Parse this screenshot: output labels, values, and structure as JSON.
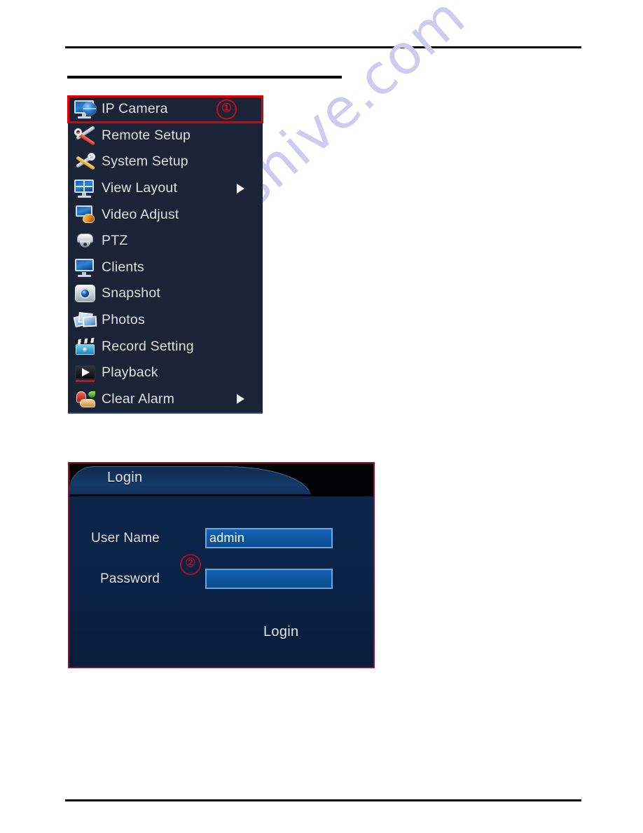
{
  "page": {
    "background_color": "#ffffff",
    "watermark": {
      "text": "manualshive.com",
      "color": "#ccccef"
    }
  },
  "context_menu": {
    "panel_color": "#1b2436",
    "highlight_color": "#e00000",
    "selected_index": 0,
    "items": [
      {
        "label": "IP Camera",
        "icon": "ip-camera-icon",
        "has_submenu": false,
        "badge": "①",
        "selected": true
      },
      {
        "label": "Remote Setup",
        "icon": "remote-setup-icon",
        "has_submenu": false,
        "badge": "",
        "selected": false
      },
      {
        "label": "System Setup",
        "icon": "system-setup-icon",
        "has_submenu": false,
        "badge": "",
        "selected": false
      },
      {
        "label": "View Layout",
        "icon": "view-layout-icon",
        "has_submenu": true,
        "badge": "",
        "selected": false
      },
      {
        "label": "Video Adjust",
        "icon": "video-adjust-icon",
        "has_submenu": false,
        "badge": "",
        "selected": false
      },
      {
        "label": "PTZ",
        "icon": "ptz-camera-icon",
        "has_submenu": false,
        "badge": "",
        "selected": false
      },
      {
        "label": "Clients",
        "icon": "clients-icon",
        "has_submenu": false,
        "badge": "",
        "selected": false
      },
      {
        "label": "Snapshot",
        "icon": "snapshot-icon",
        "has_submenu": false,
        "badge": "",
        "selected": false
      },
      {
        "label": "Photos",
        "icon": "photos-icon",
        "has_submenu": false,
        "badge": "",
        "selected": false
      },
      {
        "label": "Record Setting",
        "icon": "record-setting-icon",
        "has_submenu": false,
        "badge": "",
        "selected": false
      },
      {
        "label": "Playback",
        "icon": "playback-icon",
        "has_submenu": false,
        "badge": "",
        "selected": false
      },
      {
        "label": "Clear Alarm",
        "icon": "clear-alarm-icon",
        "has_submenu": true,
        "badge": "",
        "selected": false
      }
    ]
  },
  "login_dialog": {
    "title": "Login",
    "border_color": "#8d1230",
    "badge": "②",
    "fields": {
      "username_label": "User Name",
      "username_value": "admin",
      "password_label": "Password",
      "password_value": ""
    },
    "submit_label": "Login"
  }
}
